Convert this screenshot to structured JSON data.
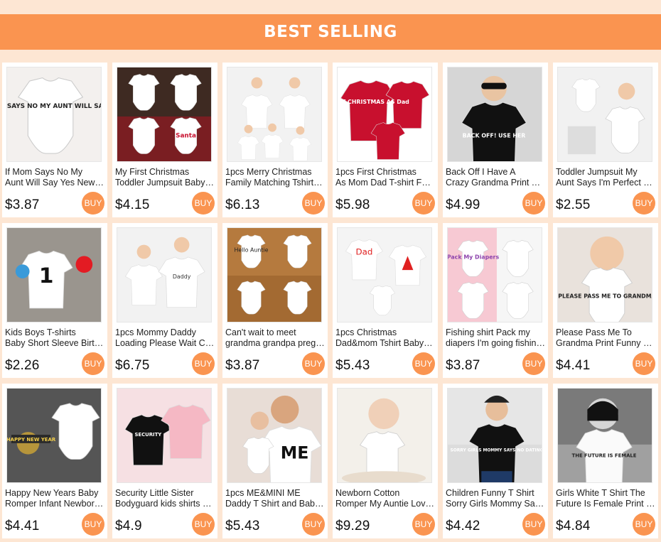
{
  "header": {
    "title": "BEST SELLING"
  },
  "colors": {
    "accent": "#fa9450",
    "background": "#fde6d3"
  },
  "buy_label": "BUY",
  "products": [
    {
      "title1": "If Mom Says No My",
      "title2": "Aunt Will Say Yes Newborn Baby Bodysuit",
      "price": "$3.87",
      "image_text": "IF MOM SAYS NO MY AUNT WILL SAY YES"
    },
    {
      "title1": "My First Christmas",
      "title2": "Toddler Jumpsuit Baby Romper",
      "price": "$4.15",
      "image_text": "Santa"
    },
    {
      "title1": "1pcs Merry Christmas",
      "title2": "Family Matching Tshirt Outfits",
      "price": "$6.13",
      "image_text": ""
    },
    {
      "title1": "1pcs First Christmas",
      "title2": "As Mom Dad T-shirt Family Look",
      "price": "$5.98",
      "image_text": "FIRST CHRISTMAS AS Dad"
    },
    {
      "title1": "Back Off I Have A",
      "title2": "Crazy Grandma Print T Shirt",
      "price": "$4.99",
      "image_text": "BACK OFF! USE HER"
    },
    {
      "title1": "Toddler Jumpsuit My",
      "title2": "Aunt Says I'm Perfect Baby Romper",
      "price": "$2.55",
      "image_text": ""
    },
    {
      "title1": "Kids Boys T-shirts",
      "title2": "Baby Short Sleeve Birthday Number Tee",
      "price": "$2.26",
      "image_text": "1"
    },
    {
      "title1": "1pcs Mommy Daddy",
      "title2": "Loading Please Wait Couple Shirts",
      "price": "$6.75",
      "image_text": "Daddy"
    },
    {
      "title1": "Can't wait to meet",
      "title2": "grandma grandpa pregnancy announcement",
      "price": "$3.87",
      "image_text": "Hello Auntie"
    },
    {
      "title1": "1pcs Christmas",
      "title2": "Dad&mom Tshirt Baby Romper Family Set",
      "price": "$5.43",
      "image_text": "Dad"
    },
    {
      "title1": "Fishing shirt Pack my",
      "title2": "diapers I'm going fishing with daddy",
      "price": "$3.87",
      "image_text": "Pack My Diapers"
    },
    {
      "title1": "Please Pass Me To",
      "title2": "Grandma Print Funny Baby Romper",
      "price": "$4.41",
      "image_text": "PLEASE PASS ME TO GRANDMA"
    },
    {
      "title1": "Happy New Years Baby",
      "title2": "Romper Infant Newborn My First New Year",
      "price": "$4.41",
      "image_text": "HAPPY NEW YEAR"
    },
    {
      "title1": "Security Little Sister",
      "title2": "Bodyguard kids shirts sibling set",
      "price": "$4.9",
      "image_text": "SECURITY"
    },
    {
      "title1": "1pcs ME&MINI ME",
      "title2": "Daddy T Shirt and Baby Romper",
      "price": "$5.43",
      "image_text": "ME"
    },
    {
      "title1": "Newborn Cotton",
      "title2": "Romper My Auntie Loves Me To The Moon",
      "price": "$9.29",
      "image_text": ""
    },
    {
      "title1": "Children Funny T Shirt",
      "title2": "Sorry Girls Mommy Says No Dating",
      "price": "$4.42",
      "image_text": "SORRY GIRLS MOMMY SAYS NO DATING"
    },
    {
      "title1": "Girls White T Shirt The",
      "title2": "Future Is Female Print Kids Tee",
      "price": "$4.84",
      "image_text": "THE FUTURE IS FEMALE"
    }
  ]
}
